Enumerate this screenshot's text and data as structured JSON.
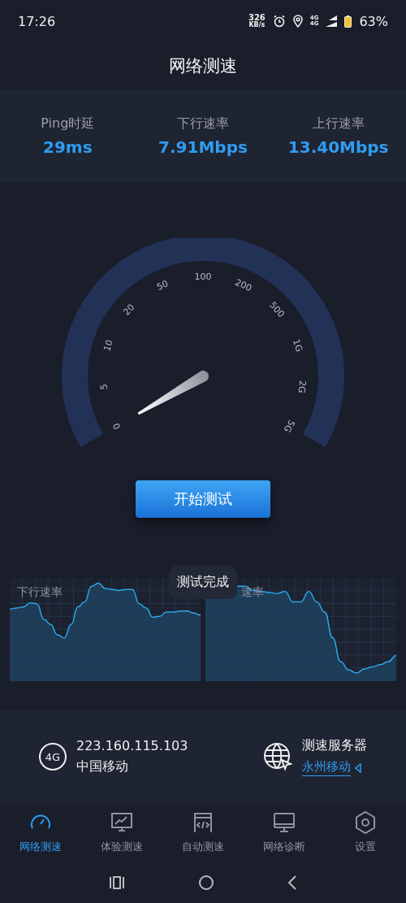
{
  "status_bar": {
    "time": "17:26",
    "net_speed": "326",
    "net_unit": "KB/s",
    "network_top": "4G",
    "network_bottom": "4G",
    "battery": "63%"
  },
  "title": "网络测速",
  "stats": [
    {
      "label": "Ping时延",
      "value": "29ms"
    },
    {
      "label": "下行速率",
      "value": "7.91Mbps"
    },
    {
      "label": "上行速率",
      "value": "13.40Mbps"
    }
  ],
  "gauge": {
    "scale": [
      "0",
      "5",
      "10",
      "20",
      "50",
      "100",
      "200",
      "500",
      "1G",
      "2G",
      "5G"
    ]
  },
  "start_button": "开始测试",
  "charts": [
    {
      "label": "下行速率"
    },
    {
      "label": "速率"
    }
  ],
  "toast": "测试完成",
  "network": {
    "badge": "4G",
    "ip": "223.160.115.103",
    "carrier": "中国移动"
  },
  "server": {
    "title": "测速服务器",
    "name": "永州移动"
  },
  "tabs": [
    {
      "label": "网络测速",
      "selected": true
    },
    {
      "label": "体验测速",
      "selected": false
    },
    {
      "label": "自动测速",
      "selected": false
    },
    {
      "label": "网络诊断",
      "selected": false
    },
    {
      "label": "设置",
      "selected": false
    }
  ]
}
